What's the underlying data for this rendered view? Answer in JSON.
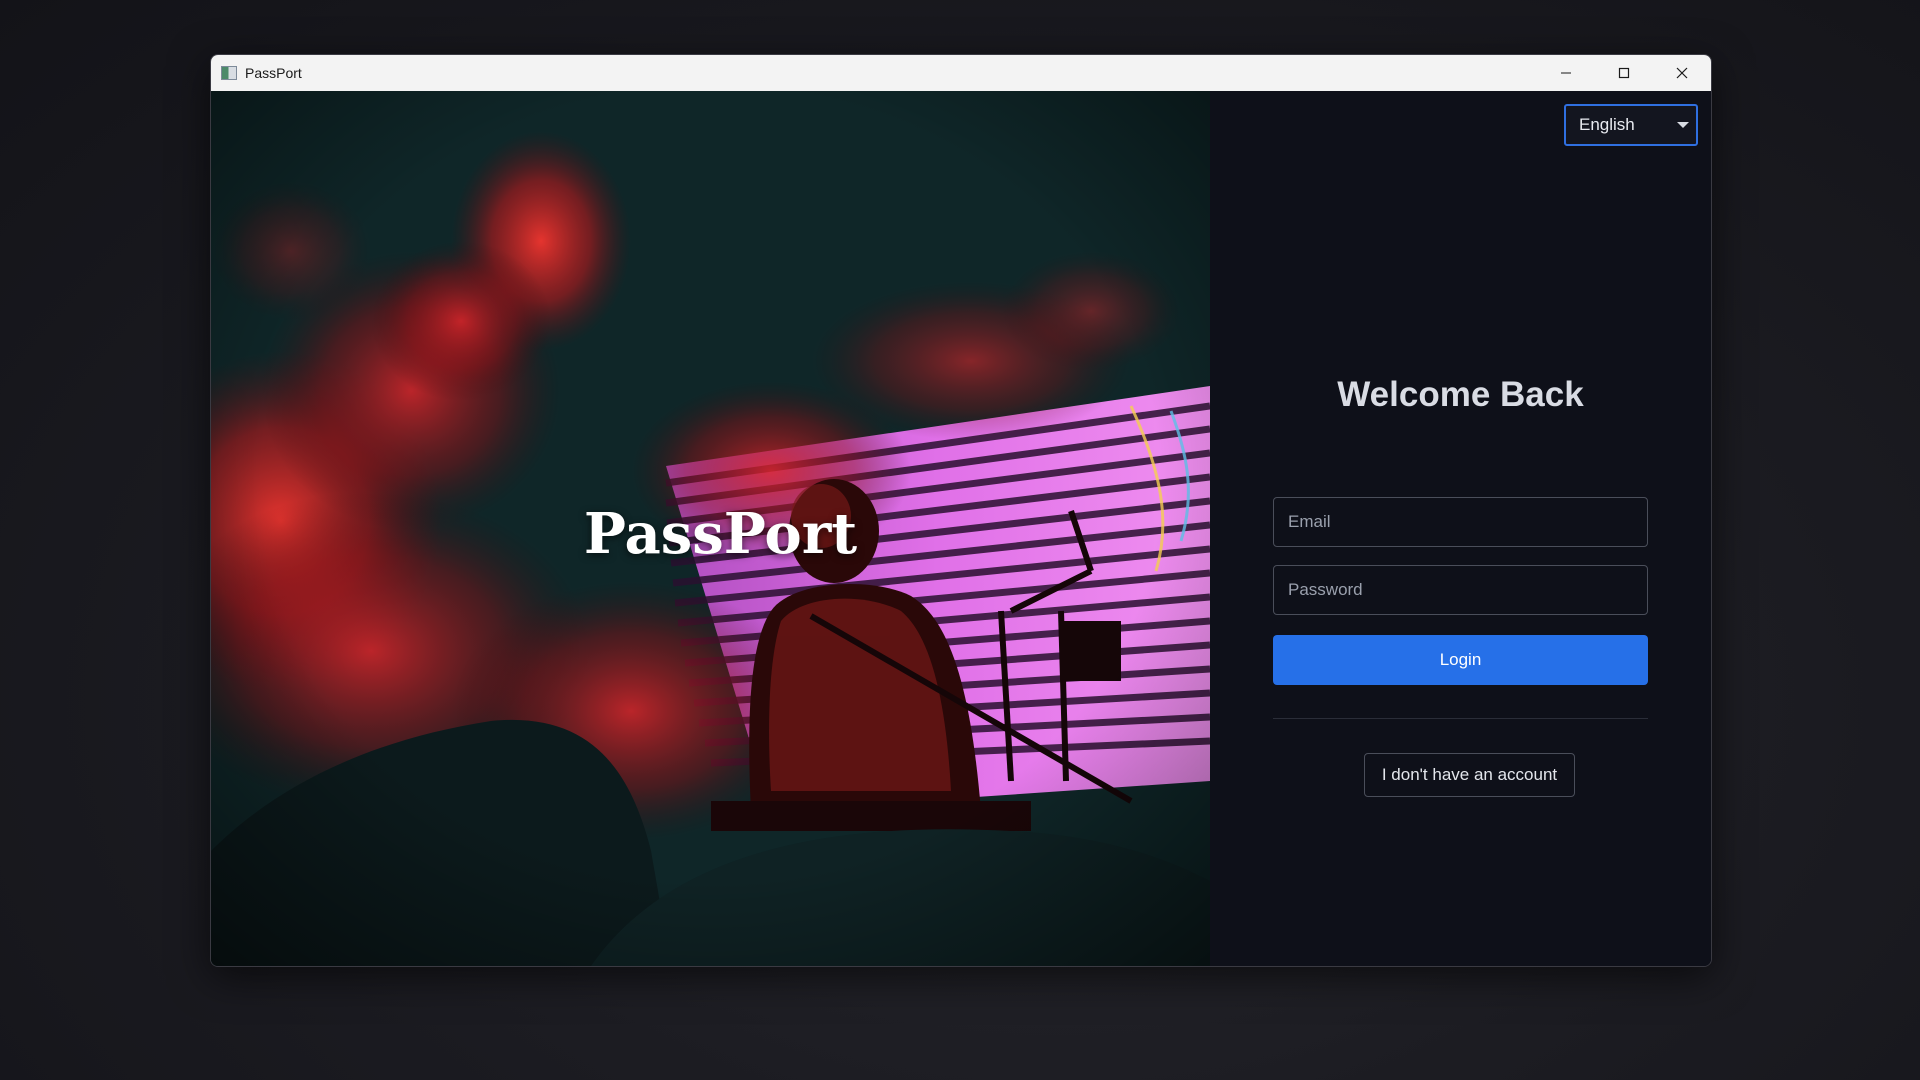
{
  "window": {
    "title": "PassPort",
    "controls": {
      "minimize": "minimize-icon",
      "maximize": "maximize-icon",
      "close": "close-icon"
    }
  },
  "hero": {
    "brand": "PassPort",
    "image": "concert-performer-photo"
  },
  "login": {
    "language": {
      "selected": "English"
    },
    "heading": "Welcome Back",
    "email": {
      "placeholder": "Email",
      "value": ""
    },
    "password": {
      "placeholder": "Password",
      "value": ""
    },
    "login_label": "Login",
    "no_account_label": "I don't have an account"
  },
  "colors": {
    "accent": "#2670e8",
    "panel_background": "#0e1019",
    "select_border": "#2f6fe0",
    "hero_red": "#d8252a",
    "hero_magenta": "#e070e8"
  }
}
